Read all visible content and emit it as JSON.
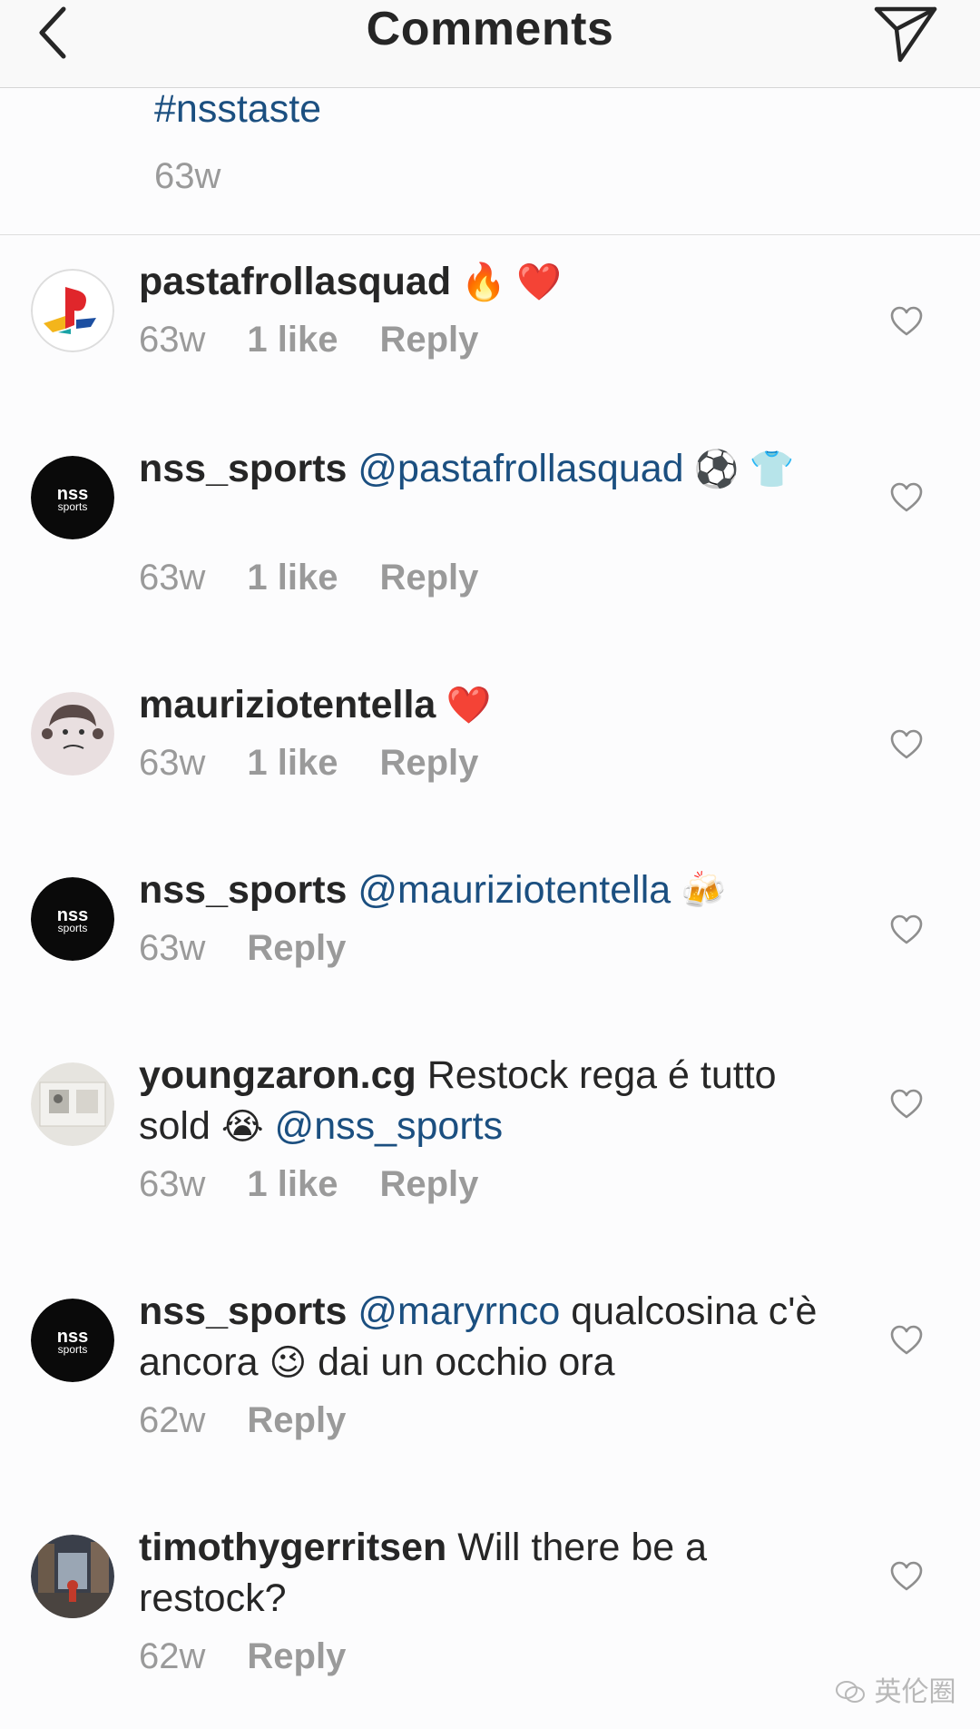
{
  "header": {
    "title": "Comments"
  },
  "caption": {
    "hashtag": "#nsstaste",
    "time": "63w"
  },
  "comments": [
    {
      "username": "pastafrollasquad",
      "segments": [
        {
          "type": "emoji",
          "text": " 🔥 ❤️"
        }
      ],
      "time": "63w",
      "likes": "1 like",
      "reply": "Reply",
      "avatar": "playstation-logo"
    },
    {
      "username": "nss_sports",
      "segments": [
        {
          "type": "mention",
          "text": " @pastafrollasquad"
        },
        {
          "type": "emoji",
          "text": " ⚽ 👕"
        }
      ],
      "time": "63w",
      "likes": "1 like",
      "reply": "Reply",
      "avatar": "nss-logo"
    },
    {
      "username": "mauriziotentella",
      "segments": [
        {
          "type": "emoji",
          "text": " ❤️"
        }
      ],
      "time": "63w",
      "likes": "1 like",
      "reply": "Reply",
      "avatar": "cartoon-face"
    },
    {
      "username": "nss_sports",
      "segments": [
        {
          "type": "mention",
          "text": " @mauriziotentella"
        },
        {
          "type": "emoji",
          "text": " 🍻"
        }
      ],
      "time": "63w",
      "likes": "",
      "reply": "Reply",
      "avatar": "nss-logo"
    },
    {
      "username": "youngzaron.cg",
      "segments": [
        {
          "type": "text",
          "text": " Restock rega é tutto sold "
        },
        {
          "type": "emoji",
          "text": "😭"
        },
        {
          "type": "mention",
          "text": "  @nss_sports"
        }
      ],
      "time": "63w",
      "likes": "1 like",
      "reply": "Reply",
      "avatar": "photo-room"
    },
    {
      "username": "nss_sports",
      "segments": [
        {
          "type": "mention",
          "text": " @maryrnco"
        },
        {
          "type": "text",
          "text": "  qualcosina c'è ancora "
        },
        {
          "type": "emoji",
          "text": "😉"
        },
        {
          "type": "text",
          "text": " dai un occhio ora"
        }
      ],
      "time": "62w",
      "likes": "",
      "reply": "Reply",
      "avatar": "nss-logo"
    },
    {
      "username": "timothygerritsen",
      "segments": [
        {
          "type": "text",
          "text": " Will there be a restock?"
        }
      ],
      "time": "62w",
      "likes": "",
      "reply": "Reply",
      "avatar": "photo-street"
    }
  ],
  "avatar_logo_text": {
    "top": "nss",
    "bottom": "sports"
  },
  "watermark": "英伦圈",
  "colors": {
    "mention": "#1b4f80",
    "meta": "#9a9a9a",
    "text": "#262626"
  }
}
